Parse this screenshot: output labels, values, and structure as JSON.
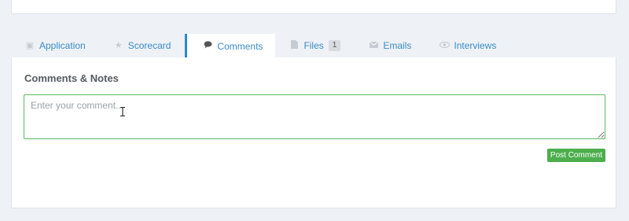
{
  "tabs": [
    {
      "label": "Application",
      "icon": "document-icon"
    },
    {
      "label": "Scorecard",
      "icon": "star-icon"
    },
    {
      "label": "Comments",
      "icon": "speech-bubble-icon",
      "active": true
    },
    {
      "label": "Files",
      "icon": "file-icon",
      "badge": "1"
    },
    {
      "label": "Emails",
      "icon": "envelope-icon"
    },
    {
      "label": "Interviews",
      "icon": "eye-icon"
    }
  ],
  "comments": {
    "title": "Comments & Notes",
    "placeholder": "Enter your comment...",
    "value": "",
    "submit_label": "Post Comment"
  },
  "colors": {
    "accent": "#3a8cc7",
    "active_border": "#2f87c9",
    "input_border": "#5cb85c",
    "button": "#4cae4c",
    "background": "#eef1f5"
  }
}
